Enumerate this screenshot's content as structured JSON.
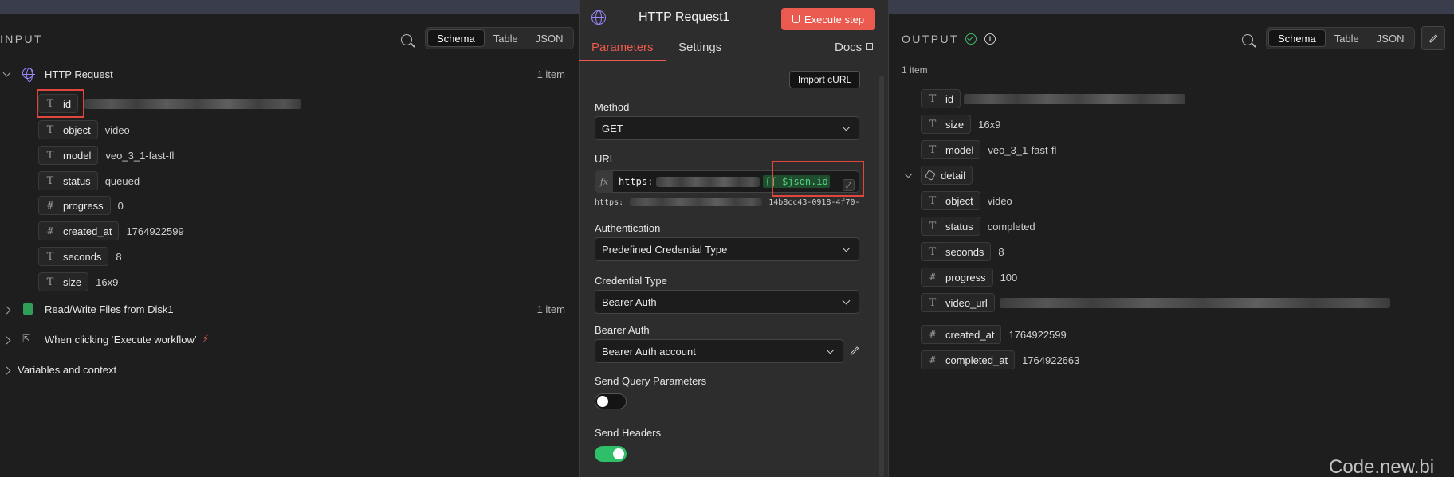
{
  "input": {
    "title": "INPUT",
    "views": [
      "Schema",
      "Table",
      "JSON"
    ],
    "active_view": "Schema",
    "nodes": [
      {
        "label": "HTTP Request",
        "count": "1 item",
        "icon": "globe-icon",
        "fields": [
          {
            "type": "T",
            "name": "id",
            "value": ""
          },
          {
            "type": "T",
            "name": "object",
            "value": "video"
          },
          {
            "type": "T",
            "name": "model",
            "value": "veo_3_1-fast-fl"
          },
          {
            "type": "T",
            "name": "status",
            "value": "queued"
          },
          {
            "type": "#",
            "name": "progress",
            "value": "0"
          },
          {
            "type": "#",
            "name": "created_at",
            "value": "1764922599"
          },
          {
            "type": "T",
            "name": "seconds",
            "value": "8"
          },
          {
            "type": "T",
            "name": "size",
            "value": "16x9"
          }
        ]
      },
      {
        "label": "Read/Write Files from Disk1",
        "count": "1 item",
        "icon": "file-icon"
      },
      {
        "label": "When clicking ‘Execute workflow’",
        "count": "",
        "icon": "cursor-click-icon"
      }
    ],
    "variables_label": "Variables and context"
  },
  "params": {
    "node_title": "HTTP Request1",
    "execute_label": "Execute step",
    "tabs": [
      "Parameters",
      "Settings"
    ],
    "docs_label": "Docs",
    "import_curl_label": "Import cURL",
    "method_label": "Method",
    "method_value": "GET",
    "url_label": "URL",
    "url_prefix": "https:",
    "url_expression": "{{ $json.id",
    "url_preview_prefix": "https:",
    "url_preview_suffix": "14b8cc43-0918-4f70-9…",
    "authentication_label": "Authentication",
    "authentication_value": "Predefined Credential Type",
    "credential_type_label": "Credential Type",
    "credential_type_value": "Bearer Auth",
    "bearer_auth_label": "Bearer Auth",
    "bearer_auth_value": "Bearer Auth account",
    "send_query_label": "Send Query Parameters",
    "send_query_on": false,
    "send_headers_label": "Send Headers",
    "send_headers_on": true
  },
  "output": {
    "title": "OUTPUT",
    "count": "1 item",
    "views": [
      "Schema",
      "Table",
      "JSON"
    ],
    "active_view": "Schema",
    "fields": [
      {
        "type": "T",
        "name": "id",
        "value": ""
      },
      {
        "type": "T",
        "name": "size",
        "value": "16x9"
      },
      {
        "type": "T",
        "name": "model",
        "value": "veo_3_1-fast-fl"
      }
    ],
    "detail_label": "detail",
    "detail_fields": [
      {
        "type": "T",
        "name": "object",
        "value": "video"
      },
      {
        "type": "T",
        "name": "status",
        "value": "completed"
      },
      {
        "type": "T",
        "name": "seconds",
        "value": "8"
      },
      {
        "type": "#",
        "name": "progress",
        "value": "100"
      },
      {
        "type": "T",
        "name": "video_url",
        "value": ""
      },
      {
        "type": "#",
        "name": "created_at",
        "value": "1764922599"
      },
      {
        "type": "#",
        "name": "completed_at",
        "value": "1764922663"
      }
    ]
  },
  "watermark": "Code.new.bi",
  "colors": {
    "accent": "#ea5a4f",
    "success": "#3fb96b",
    "expression": "#52d37f",
    "node_icon": "#9c88ff"
  }
}
